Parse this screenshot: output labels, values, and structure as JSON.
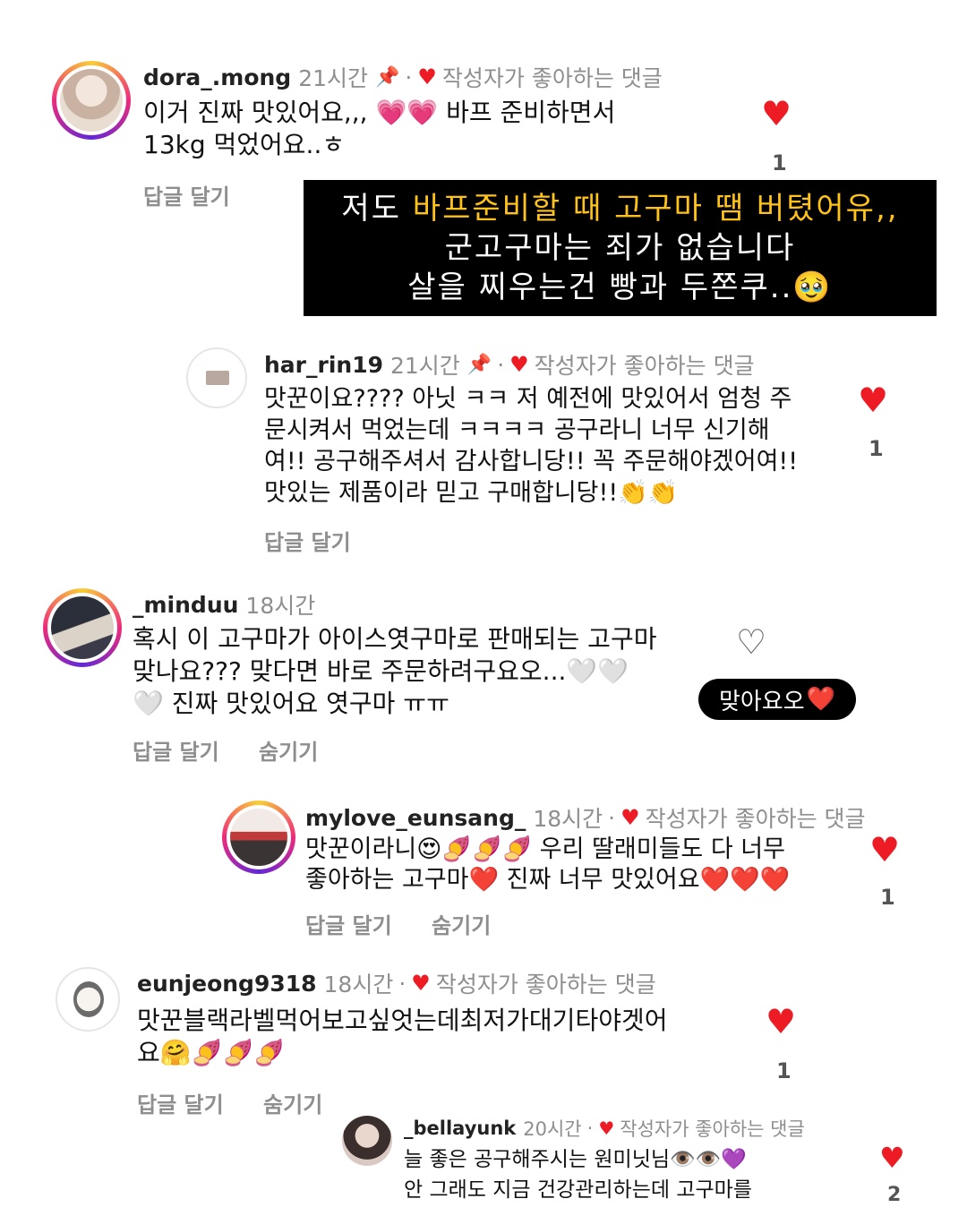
{
  "comments": [
    {
      "username": "dora_.mong",
      "time": "21시간",
      "pin_icon": "📌",
      "liked_heart": "♥",
      "liked_label": "작성자가 좋아하는 댓글",
      "lines": [
        "이거 진짜 맛있어요,,, 💗💗 바프 준비하면서",
        "13kg 먹었어요..ㅎ"
      ],
      "reply_label": "답글 달기",
      "like_icon": "♥",
      "like_count": "1"
    },
    {
      "username": "har_rin19",
      "time": "21시간",
      "pin_icon": "📌",
      "liked_heart": "♥",
      "liked_label": "작성자가 좋아하는 댓글",
      "lines": [
        "맛꾼이요???? 아닛 ㅋㅋ 저 예전에 맛있어서 엄청 주",
        "문시켜서 먹었는데 ㅋㅋㅋㅋ 공구라니 너무 신기해",
        "여!! 공구해주셔서 감사합니당!! 꼭 주문해야겠어여!!",
        "맛있는 제품이라 믿고 구매합니당!!👏👏"
      ],
      "reply_label": "답글 달기",
      "like_icon": "♥",
      "like_count": "1"
    },
    {
      "username": "_minduu",
      "time": "18시간",
      "lines": [
        "혹시 이 고구마가 아이스엿구마로 판매되는 고구마",
        "맞나요??? 맞다면 바로 주문하려구요오...🤍🤍",
        "🤍 진짜 맛있어요 엿구마 ㅠㅠ"
      ],
      "reply_label": "답글 달기",
      "hide_label": "숨기기",
      "like_icon": "♡"
    },
    {
      "username": "mylove_eunsang_",
      "time": "18시간",
      "liked_heart": "♥",
      "liked_label": "작성자가 좋아하는 댓글",
      "lines": [
        "맛꾼이라니😍🍠🍠🍠 우리 딸래미들도 다 너무",
        "좋아하는 고구마❤️ 진짜 너무 맛있어요❤️❤️❤️"
      ],
      "reply_label": "답글 달기",
      "hide_label": "숨기기",
      "like_icon": "♥",
      "like_count": "1"
    },
    {
      "username": "eunjeong9318",
      "time": "18시간",
      "liked_heart": "♥",
      "liked_label": "작성자가 좋아하는 댓글",
      "lines": [
        "맛꾼블랙라벨먹어보고싶엇는데최저가대기타야겟어",
        "요🤗🍠🍠🍠"
      ],
      "reply_label": "답글 달기",
      "hide_label": "숨기기",
      "like_icon": "♥",
      "like_count": "1"
    },
    {
      "username": "_bellayunk",
      "time": "20시간",
      "liked_heart": "♥",
      "liked_label": "작성자가 좋아하는 댓글",
      "lines": [
        "늘 좋은 공구해주시는 원미닛님👁️👁️💜",
        "안 그래도 지금 건강관리하는데 고구마를"
      ],
      "like_icon": "♥",
      "like_count": "2"
    }
  ],
  "caption": {
    "line1_prefix": "저도 ",
    "line1_highlight": "바프준비할 때 고구마 땜 버텼어유,,",
    "line2": "군고구마는 죄가 없습니다",
    "line3": "살을 찌우는건 빵과 두쫀쿠..🥹"
  },
  "reply_bubble": {
    "text": "맞아요오",
    "heart": "❤️"
  }
}
